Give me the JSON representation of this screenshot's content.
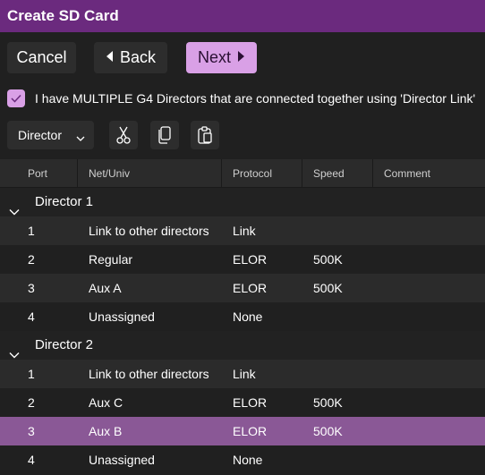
{
  "window": {
    "title": "Create SD Card"
  },
  "toolbar": {
    "cancel_label": "Cancel",
    "back_label": "Back",
    "next_label": "Next"
  },
  "options": {
    "multiple_directors_checked": true,
    "multiple_directors_label": "I have MULTIPLE G4 Directors that are connected together using 'Director Link'"
  },
  "actions": {
    "group_by_value": "Director",
    "cut_icon": "scissors-icon",
    "copy_icon": "copy-icon",
    "paste_icon": "paste-icon"
  },
  "table": {
    "columns": [
      "Port",
      "Net/Univ",
      "Protocol",
      "Speed",
      "Comment"
    ],
    "groups": [
      {
        "title": "Director 1",
        "rows": [
          {
            "port": "1",
            "net": "Link to other directors",
            "protocol": "Link",
            "speed": "",
            "comment": ""
          },
          {
            "port": "2",
            "net": "Regular",
            "protocol": "ELOR",
            "speed": "500K",
            "comment": ""
          },
          {
            "port": "3",
            "net": "Aux A",
            "protocol": "ELOR",
            "speed": "500K",
            "comment": ""
          },
          {
            "port": "4",
            "net": "Unassigned",
            "protocol": "None",
            "speed": "",
            "comment": ""
          }
        ]
      },
      {
        "title": "Director 2",
        "rows": [
          {
            "port": "1",
            "net": "Link to other directors",
            "protocol": "Link",
            "speed": "",
            "comment": ""
          },
          {
            "port": "2",
            "net": "Aux C",
            "protocol": "ELOR",
            "speed": "500K",
            "comment": ""
          },
          {
            "port": "3",
            "net": "Aux B",
            "protocol": "ELOR",
            "speed": "500K",
            "comment": ""
          },
          {
            "port": "4",
            "net": "Unassigned",
            "protocol": "None",
            "speed": "",
            "comment": ""
          }
        ]
      }
    ],
    "selected_row": "Director 2 / 3"
  },
  "colors": {
    "title_bar": "#6b2a7e",
    "accent": "#d9a0e6",
    "selected_row": "#8a5896"
  }
}
